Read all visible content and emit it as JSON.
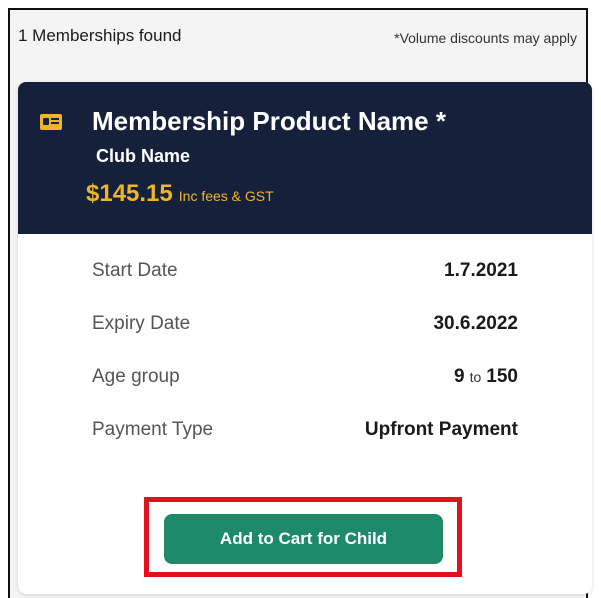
{
  "results": {
    "count_label": "1 Memberships found",
    "note": "*Volume discounts may apply"
  },
  "membership": {
    "icon": "membership-card-icon",
    "product_name": "Membership Product Name *",
    "club_name": "Club Name",
    "price": "$145.15",
    "price_note": "Inc fees & GST",
    "details": {
      "start_date_label": "Start Date",
      "start_date_value": "1.7.2021",
      "expiry_date_label": "Expiry Date",
      "expiry_date_value": "30.6.2022",
      "age_group_label": "Age group",
      "age_min": "9",
      "age_separator": "to",
      "age_max": "150",
      "payment_type_label": "Payment Type",
      "payment_type_value": "Upfront Payment"
    },
    "add_button_label": "Add to Cart for Child"
  },
  "colors": {
    "header_bg": "#15213b",
    "accent_gold": "#f0b429",
    "button_green": "#1d8a6c",
    "highlight_red": "#e3101c"
  }
}
